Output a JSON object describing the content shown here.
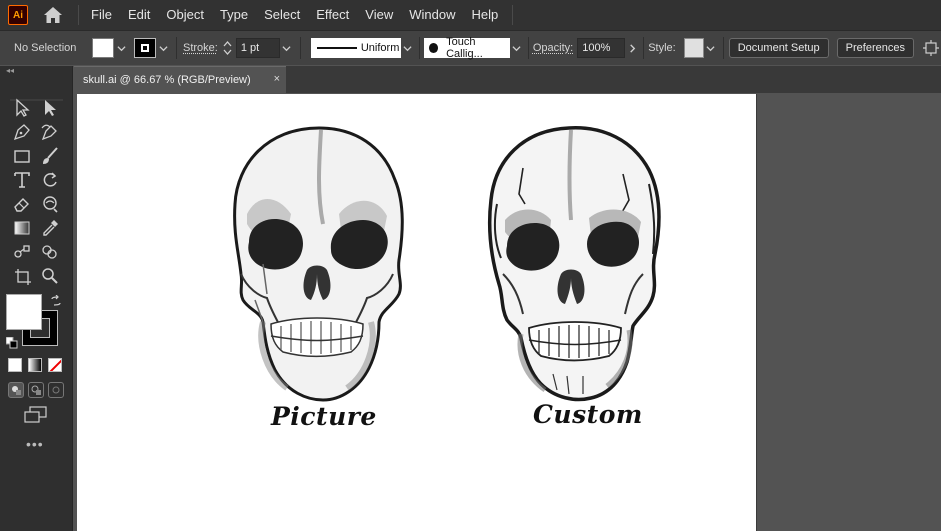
{
  "app": {
    "logo_text": "Ai"
  },
  "menu": [
    "File",
    "Edit",
    "Object",
    "Type",
    "Select",
    "Effect",
    "View",
    "Window",
    "Help"
  ],
  "control": {
    "selection_label": "No Selection",
    "stroke_label": "Stroke:",
    "stroke_weight": "1 pt",
    "profile": "Uniform",
    "brush": "Touch Callig...",
    "opacity_label": "Opacity:",
    "opacity_value": "100%",
    "style_label": "Style:",
    "document_setup": "Document Setup",
    "preferences": "Preferences"
  },
  "document": {
    "tab_title": "skull.ai @ 66.67 % (RGB/Preview)",
    "close": "×"
  },
  "artwork": {
    "caption_left": "Picture",
    "caption_right": "Custom"
  },
  "icons": {
    "home": "home-icon",
    "selection": "selection-icon",
    "direct_selection": "direct-selection-icon",
    "pen": "pen-icon",
    "curvature": "curvature-icon",
    "rectangle": "rectangle-icon",
    "brush": "paintbrush-icon",
    "type": "type-icon",
    "rotate": "rotate-icon",
    "eraser": "eraser-icon",
    "warp": "warp-icon",
    "gradient": "gradient-icon",
    "eyedropper": "eyedropper-icon",
    "blend": "blend-icon",
    "shape_builder": "shape-builder-icon",
    "artboard": "artboard-icon",
    "zoom": "zoom-icon"
  },
  "colors": {
    "menubar": "#323232",
    "controlbar": "#424242",
    "toolbar": "#2f2f2f",
    "canvas": "#535353",
    "artboard": "#ffffff"
  }
}
